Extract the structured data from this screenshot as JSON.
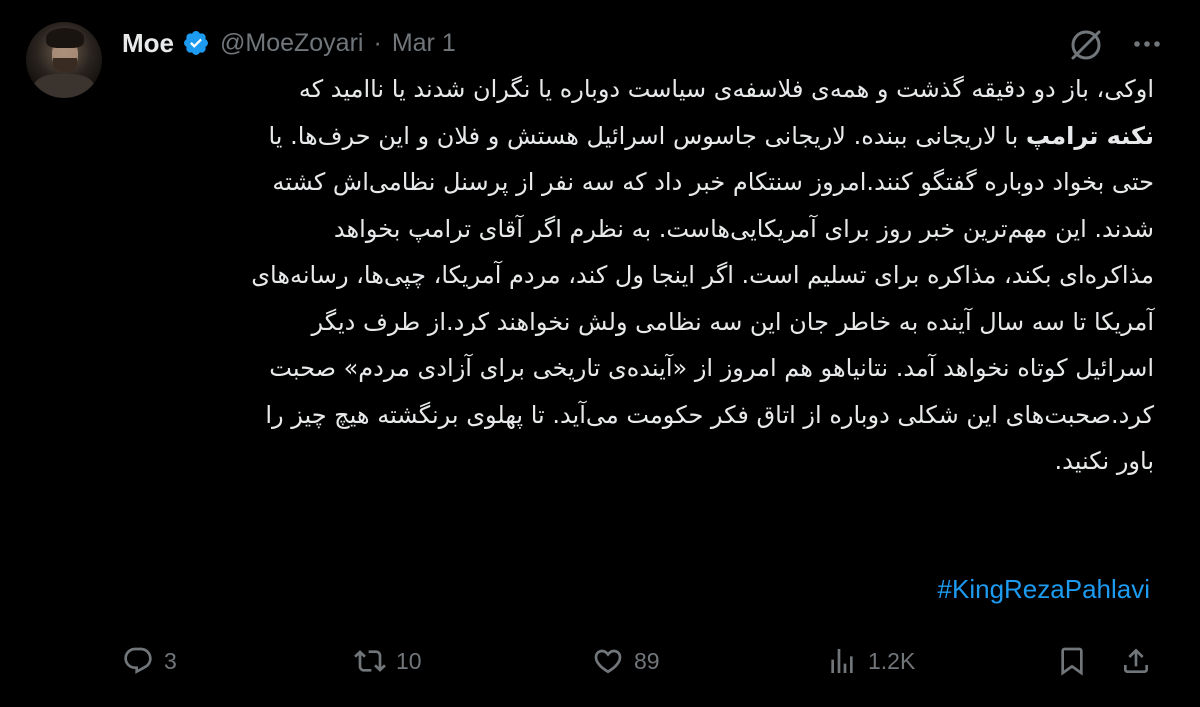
{
  "author": {
    "name": "Moe",
    "handle": "@MoeZoyari",
    "separator": "·",
    "date": "Mar 1"
  },
  "colors": {
    "background": "#000000",
    "text": "#e7e9ea",
    "muted": "#71767b",
    "accent": "#1d9bf0"
  },
  "icons": {
    "verified": "verified-badge-icon",
    "grok": "grok-icon",
    "more": "more-icon",
    "reply": "reply-icon",
    "repost": "repost-icon",
    "like": "like-icon",
    "views": "views-icon",
    "bookmark": "bookmark-icon",
    "share": "share-icon"
  },
  "tweet": {
    "lines": [
      {
        "text": "اوکی، باز دو دقیقه گذشت و همه‌ی فلاسفه‌ی سیاست دوباره یا نگران شدند یا ناامید که"
      },
      {
        "bold": "نکنه ترامپ",
        "rest": " با لاریجانی ببنده. لاریجانی جاسوس اسرائیل هستش و فلان و این حرف‌ها. یا"
      },
      {
        "text": "حتی بخواد دوباره گفتگو کنند.امروز سنتکام خبر داد که سه نفر از پرسنل نظامی‌اش کشته"
      },
      {
        "text": "شدند. این مهم‌ترین خبر روز برای آمریکایی‌هاست. به نظرم اگر آقای ترامپ بخواهد"
      },
      {
        "text": "مذاکره‌ای بکند، مذاکره برای تسلیم است. اگر اینجا ول کند، مردم آمریکا، چپی‌ها، رسانه‌های"
      },
      {
        "text": "آمریکا تا سه سال آینده به خاطر جان این سه نظامی ولش نخواهند کرد.از طرف دیگر"
      },
      {
        "text": "اسرائیل کوتاه نخواهد آمد. نتانیاهو هم امروز از «آینده‌ی تاریخی برای آزادی مردم» صحبت"
      },
      {
        "text": "کرد.صحبت‌های این شکلی دوباره از اتاق فکر حکومت می‌آید. تا پهلوی برنگشته هیچ چیز را"
      },
      {
        "text": "باور نکنید."
      }
    ],
    "hashtag": "#KingRezaPahlavi"
  },
  "stats": {
    "replies": "3",
    "reposts": "10",
    "likes": "89",
    "views": "1.2K"
  }
}
